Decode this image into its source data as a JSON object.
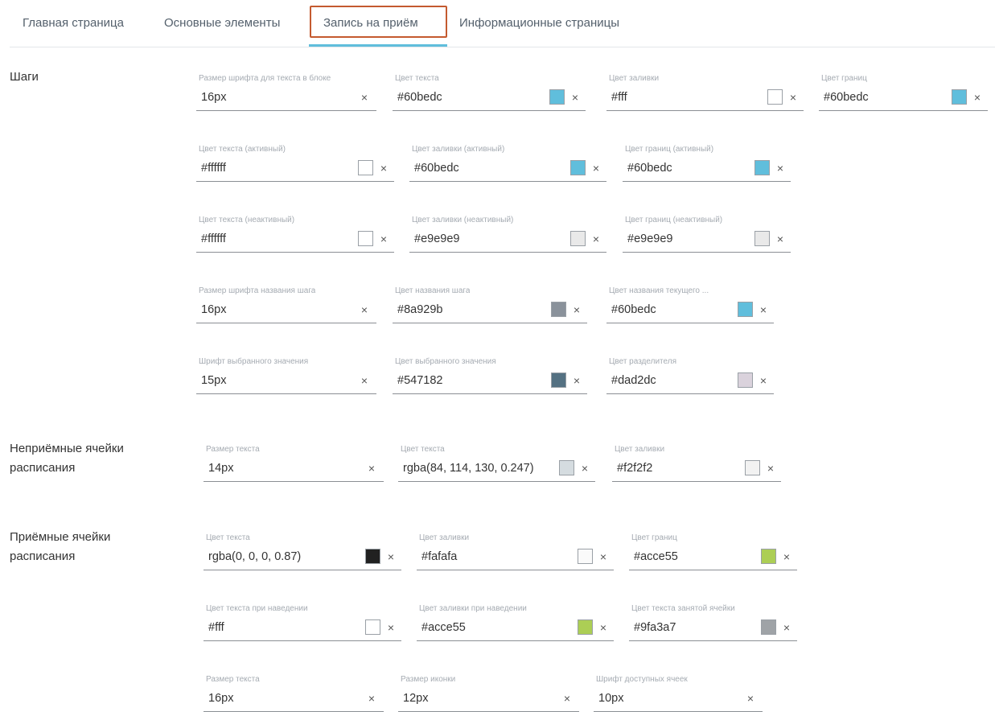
{
  "tabs": [
    "Главная страница",
    "Основные элементы",
    "Запись на приём",
    "Информационные страницы"
  ],
  "sections": {
    "steps": "Шаги",
    "non_reception": [
      "Неприёмные ячейки",
      "расписания"
    ],
    "reception": [
      "Приёмные ячейки",
      "расписания"
    ]
  },
  "clear_icon": "×",
  "fields": {
    "s1": {
      "label": "Размер шрифта для текста в блоке",
      "value": "16px"
    },
    "s2": {
      "label": "Цвет текста",
      "value": "#60bedc",
      "color": "#60bedc"
    },
    "s3": {
      "label": "Цвет заливки",
      "value": "#fff",
      "color": "#ffffff"
    },
    "s4": {
      "label": "Цвет границ",
      "value": "#60bedc",
      "color": "#60bedc"
    },
    "s5": {
      "label": "Цвет текста (активный)",
      "value": "#ffffff",
      "color": "#ffffff"
    },
    "s6": {
      "label": "Цвет заливки (активный)",
      "value": "#60bedc",
      "color": "#60bedc"
    },
    "s7": {
      "label": "Цвет границ (активный)",
      "value": "#60bedc",
      "color": "#60bedc"
    },
    "s8": {
      "label": "Цвет текста (неактивный)",
      "value": "#ffffff",
      "color": "#ffffff"
    },
    "s9": {
      "label": "Цвет заливки (неактивный)",
      "value": "#e9e9e9",
      "color": "#e9e9e9"
    },
    "s10": {
      "label": "Цвет границ (неактивный)",
      "value": "#e9e9e9",
      "color": "#e9e9e9"
    },
    "s11": {
      "label": "Размер шрифта названия шага",
      "value": "16px"
    },
    "s12": {
      "label": "Цвет названия шага",
      "value": "#8a929b",
      "color": "#8a929b"
    },
    "s13": {
      "label": "Цвет названия текущего ...",
      "value": "#60bedc",
      "color": "#60bedc"
    },
    "s14": {
      "label": "Шрифт выбранного значения",
      "value": "15px"
    },
    "s15": {
      "label": "Цвет выбранного значения",
      "value": "#547182",
      "color": "#547182"
    },
    "s16": {
      "label": "Цвет разделителя",
      "value": "#dad2dc",
      "color": "#dad2dc"
    },
    "n1": {
      "label": "Размер текста",
      "value": "14px"
    },
    "n2": {
      "label": "Цвет текста",
      "value": "rgba(84, 114, 130, 0.247)",
      "color": "rgba(84, 114, 130, 0.247)"
    },
    "n3": {
      "label": "Цвет заливки",
      "value": "#f2f2f2",
      "color": "#f2f2f2"
    },
    "r1": {
      "label": "Цвет текста",
      "value": "rgba(0, 0, 0, 0.87)",
      "color": "rgba(0, 0, 0, 0.87)"
    },
    "r2": {
      "label": "Цвет заливки",
      "value": "#fafafa",
      "color": "#fafafa"
    },
    "r3": {
      "label": "Цвет границ",
      "value": "#acce55",
      "color": "#acce55"
    },
    "r4": {
      "label": "Цвет текста при наведении",
      "value": "#fff",
      "color": "#ffffff"
    },
    "r5": {
      "label": "Цвет заливки при наведении",
      "value": "#acce55",
      "color": "#acce55"
    },
    "r6": {
      "label": "Цвет текста занятой ячейки",
      "value": "#9fa3a7",
      "color": "#9fa3a7"
    },
    "r7": {
      "label": "Размер текста",
      "value": "16px"
    },
    "r8": {
      "label": "Размер иконки",
      "value": "12px"
    },
    "r9": {
      "label": "Шрифт доступных ячеек",
      "value": "10px"
    }
  }
}
